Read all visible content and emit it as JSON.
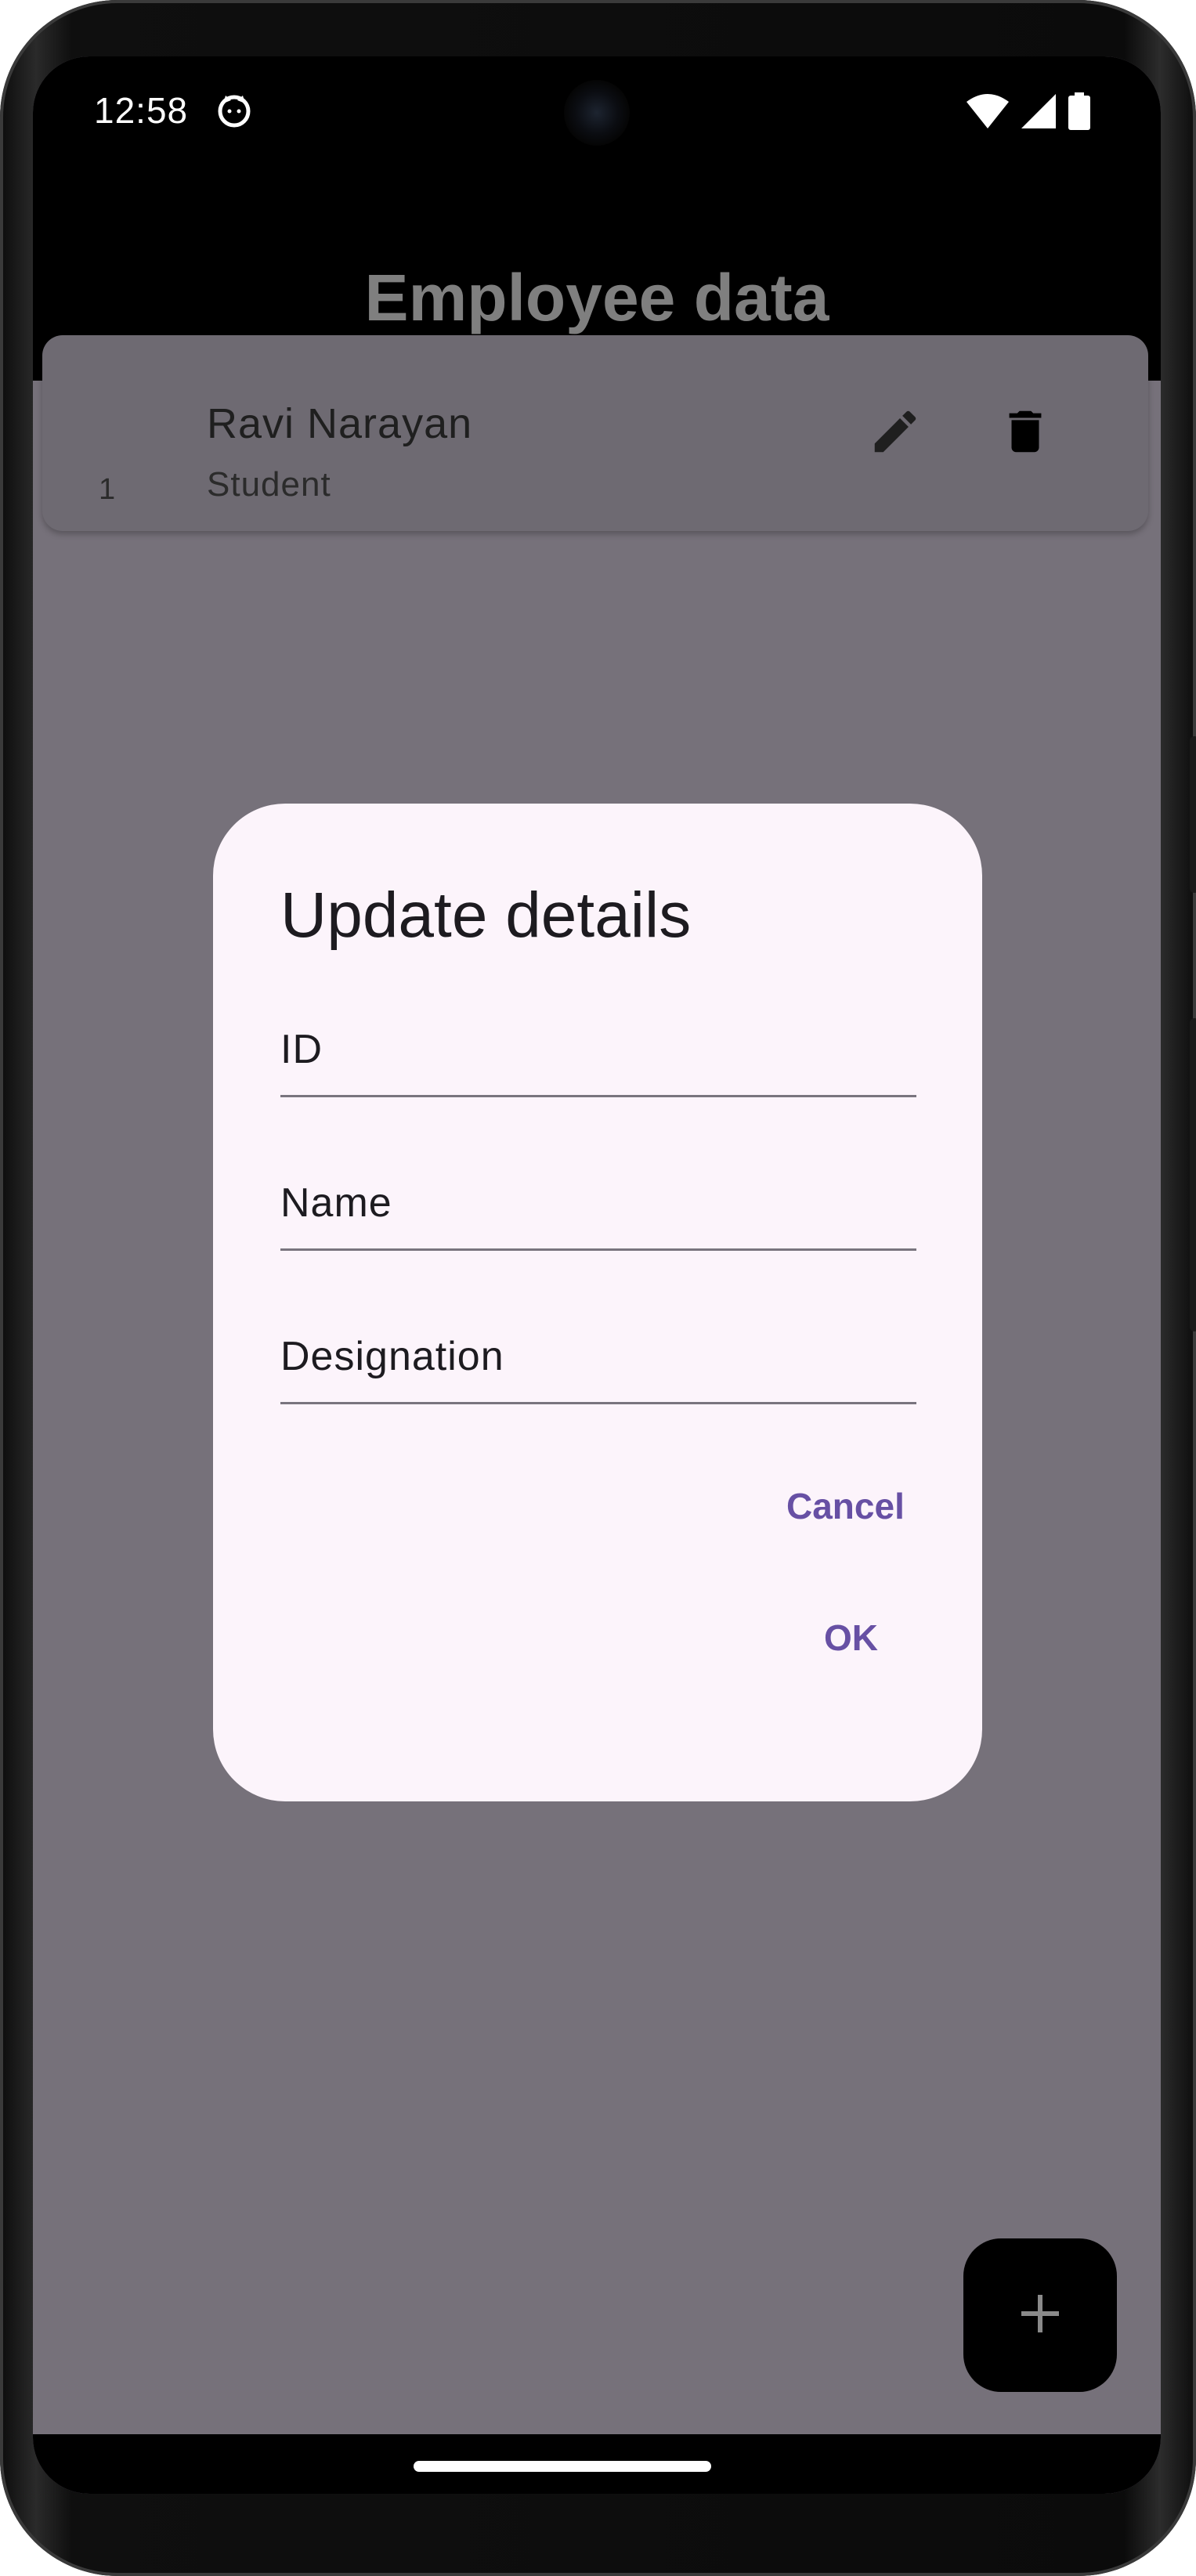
{
  "status_bar": {
    "time": "12:58",
    "icons": [
      "cat-notification-icon",
      "wifi-icon",
      "signal-icon",
      "battery-icon"
    ]
  },
  "app_bar": {
    "title": "Employee data"
  },
  "employee_list": [
    {
      "id": "1",
      "name": "Ravi Narayan",
      "designation": "Student",
      "actions": [
        "edit-icon",
        "delete-icon"
      ]
    }
  ],
  "dialog": {
    "title": "Update details",
    "fields": [
      {
        "label": "ID",
        "value": ""
      },
      {
        "label": "Name",
        "value": ""
      },
      {
        "label": "Designation",
        "value": ""
      }
    ],
    "cancel_label": "Cancel",
    "ok_label": "OK"
  },
  "fab": {
    "icon": "add-icon"
  },
  "colors": {
    "scrim": "#76717a",
    "dialog_bg": "#fcf4fb",
    "accent": "#6750a4",
    "app_bar_bg": "#000000"
  }
}
